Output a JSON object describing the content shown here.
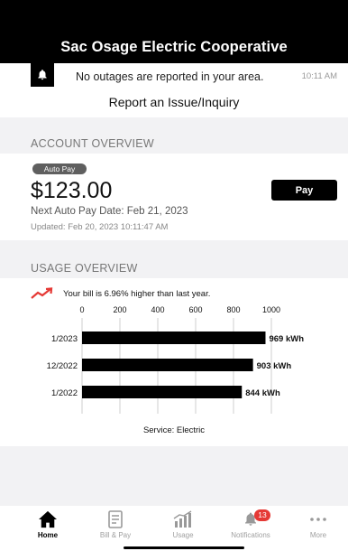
{
  "header": {
    "title": "Sac Osage Electric Cooperative"
  },
  "alert": {
    "text": "No outages are reported in your area.",
    "time": "10:11 AM",
    "icon": "bell-icon"
  },
  "report_link": "Report an Issue/Inquiry",
  "account": {
    "section_label": "ACCOUNT OVERVIEW",
    "badge": "Auto Pay",
    "amount": "$123.00",
    "pay_label": "Pay",
    "next_date": "Next Auto Pay Date: Feb 21, 2023",
    "updated": "Updated: Feb 20, 2023 10:11:47 AM"
  },
  "usage": {
    "section_label": "USAGE OVERVIEW",
    "trend_icon": "trend-up-icon",
    "trend_color": "#e53935",
    "trend_text": "Your bill is 6.96% higher than last year.",
    "service": "Service: Electric"
  },
  "chart_data": {
    "type": "bar",
    "orientation": "horizontal",
    "categories": [
      "1/2023",
      "12/2022",
      "1/2022"
    ],
    "values": [
      969,
      903,
      844
    ],
    "value_labels": [
      "969 kWh",
      "903 kWh",
      "844 kWh"
    ],
    "xticks": [
      0,
      200,
      400,
      600,
      800,
      1000
    ],
    "xlim": [
      0,
      1000
    ],
    "grid": true,
    "bar_color": "#000000"
  },
  "tabs": [
    {
      "label": "Home",
      "icon": "home-icon",
      "active": true
    },
    {
      "label": "Bill & Pay",
      "icon": "bill-icon",
      "active": false
    },
    {
      "label": "Usage",
      "icon": "usage-chart-icon",
      "active": false
    },
    {
      "label": "Notifications",
      "icon": "bell-icon",
      "active": false,
      "badge": "13"
    },
    {
      "label": "More",
      "icon": "more-icon",
      "active": false
    }
  ]
}
